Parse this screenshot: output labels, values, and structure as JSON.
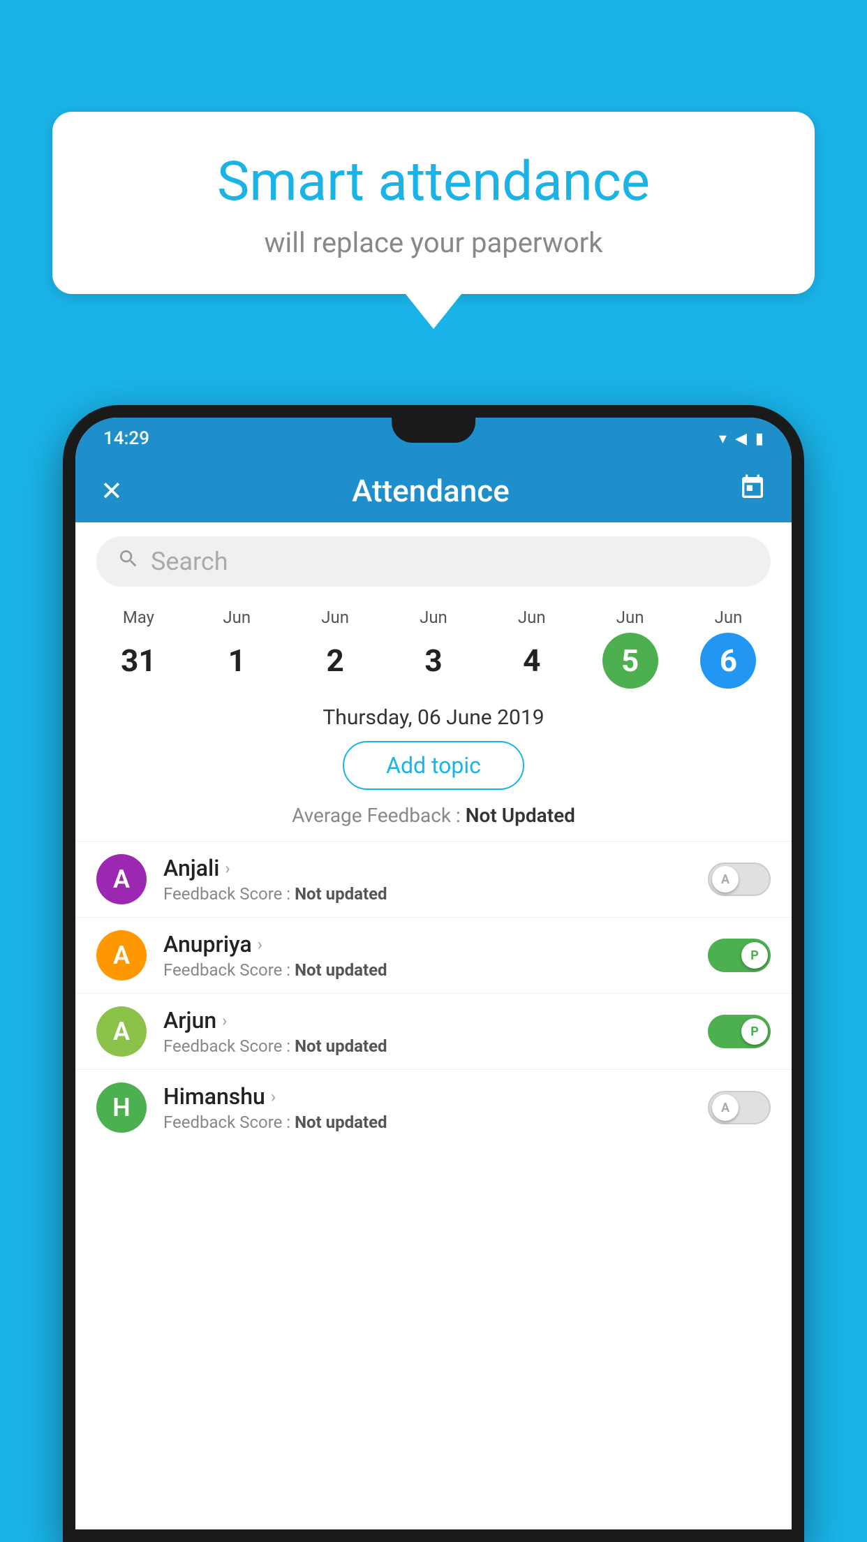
{
  "background_color": "#1ab3e8",
  "speech_bubble": {
    "title": "Smart attendance",
    "subtitle": "will replace your paperwork"
  },
  "status_bar": {
    "time": "14:29",
    "icons": [
      "▲",
      "▲",
      "▮"
    ]
  },
  "app_bar": {
    "title": "Attendance",
    "close_icon": "✕",
    "calendar_icon": "📅"
  },
  "search": {
    "placeholder": "Search"
  },
  "calendar": {
    "days": [
      {
        "month": "May",
        "number": "31",
        "style": "normal"
      },
      {
        "month": "Jun",
        "number": "1",
        "style": "normal"
      },
      {
        "month": "Jun",
        "number": "2",
        "style": "normal"
      },
      {
        "month": "Jun",
        "number": "3",
        "style": "normal"
      },
      {
        "month": "Jun",
        "number": "4",
        "style": "normal"
      },
      {
        "month": "Jun",
        "number": "5",
        "style": "green"
      },
      {
        "month": "Jun",
        "number": "6",
        "style": "blue"
      }
    ]
  },
  "selected_date": "Thursday, 06 June 2019",
  "add_topic_label": "Add topic",
  "average_feedback_label": "Average Feedback :",
  "average_feedback_value": "Not Updated",
  "students": [
    {
      "name": "Anjali",
      "initial": "A",
      "avatar_color": "purple",
      "feedback_label": "Feedback Score :",
      "feedback_value": "Not updated",
      "toggle_state": "off",
      "toggle_letter": "A"
    },
    {
      "name": "Anupriya",
      "initial": "A",
      "avatar_color": "orange",
      "feedback_label": "Feedback Score :",
      "feedback_value": "Not updated",
      "toggle_state": "on",
      "toggle_letter": "P"
    },
    {
      "name": "Arjun",
      "initial": "A",
      "avatar_color": "light-green",
      "feedback_label": "Feedback Score :",
      "feedback_value": "Not updated",
      "toggle_state": "on",
      "toggle_letter": "P"
    },
    {
      "name": "Himanshu",
      "initial": "H",
      "avatar_color": "green",
      "feedback_label": "Feedback Score :",
      "feedback_value": "Not updated",
      "toggle_state": "off",
      "toggle_letter": "A"
    }
  ]
}
